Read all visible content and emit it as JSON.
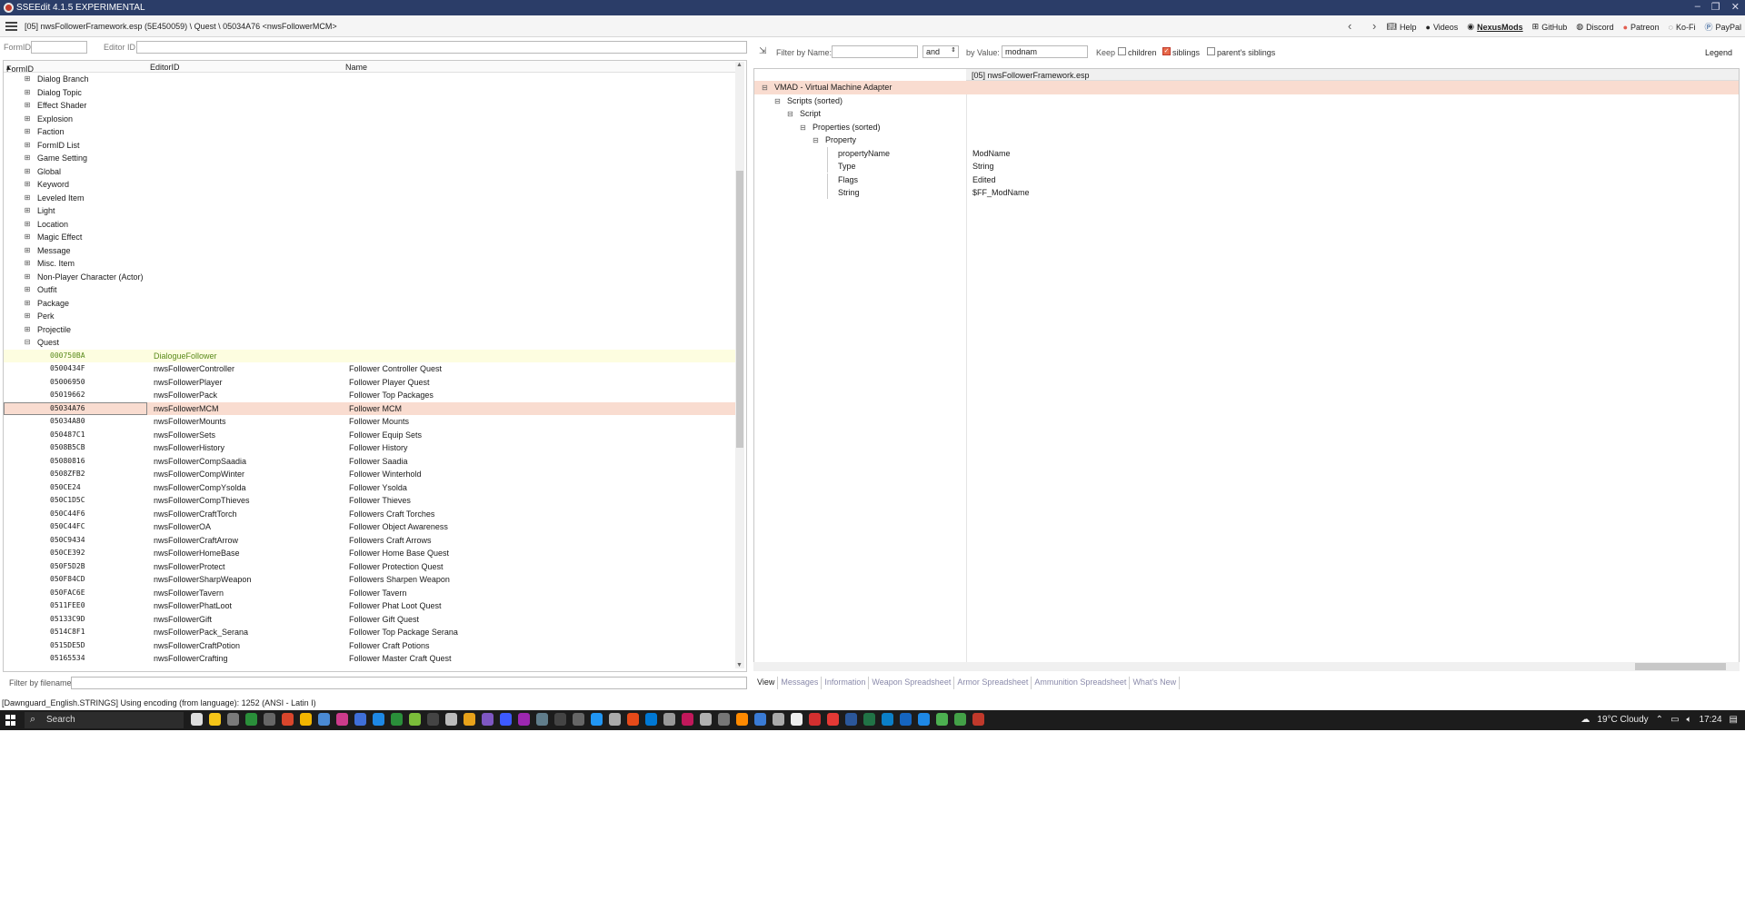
{
  "window": {
    "title": "SSEEdit 4.1.5 EXPERIMENTAL"
  },
  "nav": {
    "path": "[05] nwsFollowerFramework.esp (5E450059) \\ Quest \\ 05034A76 <nwsFollowerMCM>",
    "links": [
      {
        "icon": "book-icon",
        "label": "Help"
      },
      {
        "icon": "video-icon",
        "label": "Videos"
      },
      {
        "icon": "nexus-icon",
        "label": "NexusMods"
      },
      {
        "icon": "github-icon",
        "label": "GitHub"
      },
      {
        "icon": "discord-icon",
        "label": "Discord"
      },
      {
        "icon": "patreon-icon",
        "label": "Patreon"
      },
      {
        "icon": "kofi-icon",
        "label": "Ko-Fi"
      },
      {
        "icon": "paypal-icon",
        "label": "PayPal"
      }
    ]
  },
  "leftfilter": {
    "formid_label": "FormID",
    "editorid_label": "Editor ID",
    "formid_value": "",
    "editorid_value": ""
  },
  "tree": {
    "columns": {
      "formid": "FormID",
      "editorid": "EditorID",
      "name": "Name"
    },
    "groups": [
      "Dialog Branch",
      "Dialog Topic",
      "Effect Shader",
      "Explosion",
      "Faction",
      "FormID List",
      "Game Setting",
      "Global",
      "Keyword",
      "Leveled Item",
      "Light",
      "Location",
      "Magic Effect",
      "Message",
      "Misc. Item",
      "Non-Player Character (Actor)",
      "Outfit",
      "Package",
      "Perk",
      "Projectile",
      "Quest"
    ],
    "records": [
      {
        "formid": "000750BA",
        "editorid": "DialogueFollower",
        "name": ""
      },
      {
        "formid": "0500434F",
        "editorid": "nwsFollowerController",
        "name": "Follower Controller Quest"
      },
      {
        "formid": "05006950",
        "editorid": "nwsFollowerPlayer",
        "name": "Follower Player Quest"
      },
      {
        "formid": "05019662",
        "editorid": "nwsFollowerPack",
        "name": "Follower Top Packages"
      },
      {
        "formid": "05034A76",
        "editorid": "nwsFollowerMCM",
        "name": "Follower MCM"
      },
      {
        "formid": "05034A80",
        "editorid": "nwsFollowerMounts",
        "name": "Follower Mounts"
      },
      {
        "formid": "050487C1",
        "editorid": "nwsFollowerSets",
        "name": "Follower Equip Sets"
      },
      {
        "formid": "0508B5CB",
        "editorid": "nwsFollowerHistory",
        "name": "Follower History"
      },
      {
        "formid": "05080816",
        "editorid": "nwsFollowerCompSaadia",
        "name": "Follower Saadia"
      },
      {
        "formid": "0508ZFB2",
        "editorid": "nwsFollowerCompWinter",
        "name": "Follower Winterhold"
      },
      {
        "formid": "050CE24",
        "editorid": "nwsFollowerCompYsolda",
        "name": "Follower Ysolda"
      },
      {
        "formid": "050C1D5C",
        "editorid": "nwsFollowerCompThieves",
        "name": "Follower Thieves"
      },
      {
        "formid": "050C44F6",
        "editorid": "nwsFollowerCraftTorch",
        "name": "Followers Craft Torches"
      },
      {
        "formid": "050C44FC",
        "editorid": "nwsFollowerOA",
        "name": "Follower Object Awareness"
      },
      {
        "formid": "050C9434",
        "editorid": "nwsFollowerCraftArrow",
        "name": "Followers Craft Arrows"
      },
      {
        "formid": "050CE392",
        "editorid": "nwsFollowerHomeBase",
        "name": "Follower Home Base Quest"
      },
      {
        "formid": "050F5D2B",
        "editorid": "nwsFollowerProtect",
        "name": "Follower Protection Quest"
      },
      {
        "formid": "050F84CD",
        "editorid": "nwsFollowerSharpWeapon",
        "name": "Followers Sharpen Weapon"
      },
      {
        "formid": "050FAC6E",
        "editorid": "nwsFollowerTavern",
        "name": "Follower Tavern"
      },
      {
        "formid": "0511FEE0",
        "editorid": "nwsFollowerPhatLoot",
        "name": "Follower Phat Loot Quest"
      },
      {
        "formid": "05133C9D",
        "editorid": "nwsFollowerGift",
        "name": "Follower Gift Quest"
      },
      {
        "formid": "0514C8F1",
        "editorid": "nwsFollowerPack_Serana",
        "name": "Follower Top Package Serana"
      },
      {
        "formid": "0515DE5D",
        "editorid": "nwsFollowerCraftPotion",
        "name": "Follower Craft Potions"
      },
      {
        "formid": "05165534",
        "editorid": "nwsFollowerCrafting",
        "name": "Follower Master Craft Quest"
      }
    ]
  },
  "rightfilter": {
    "filter_name_label": "Filter by Name:",
    "filter_name_value": "",
    "op_value": "and",
    "by_value_label": "by Value:",
    "by_value_value": "modnam",
    "keep_label": "Keep",
    "children_label": "children",
    "siblings_label": "siblings",
    "parents_siblings_label": "parent's siblings",
    "legend_label": "Legend",
    "children_checked": false,
    "siblings_checked": true,
    "parents_siblings_checked": false
  },
  "record_view": {
    "column_header": "[05] nwsFollowerFramework.esp",
    "rows": [
      {
        "label": "VMAD - Virtual Machine Adapter",
        "value": ""
      },
      {
        "label": "Scripts (sorted)",
        "value": ""
      },
      {
        "label": "Script",
        "value": ""
      },
      {
        "label": "Properties (sorted)",
        "value": ""
      },
      {
        "label": "Property",
        "value": ""
      },
      {
        "label": "propertyName",
        "value": "ModName"
      },
      {
        "label": "Type",
        "value": "String"
      },
      {
        "label": "Flags",
        "value": "Edited"
      },
      {
        "label": "String",
        "value": "$FF_ModName"
      }
    ]
  },
  "tabs": [
    "View",
    "Messages",
    "Information",
    "Weapon Spreadsheet",
    "Armor Spreadsheet",
    "Ammunition Spreadsheet",
    "What's New"
  ],
  "filename_filter": {
    "label": "Filter by filename:",
    "value": ""
  },
  "status": {
    "text": "[Dawnguard_English.STRINGS] Using encoding (from language): 1252  (ANSI - Latin I)"
  },
  "taskbar": {
    "search_label": "Search",
    "weather": "19°C  Cloudy",
    "time": "17:24"
  },
  "colors": {
    "titlebar": "#2b3d68",
    "selected_row": "#f9dcd0",
    "highlight_row": "#fdfde0",
    "accent": "#c0392b"
  }
}
